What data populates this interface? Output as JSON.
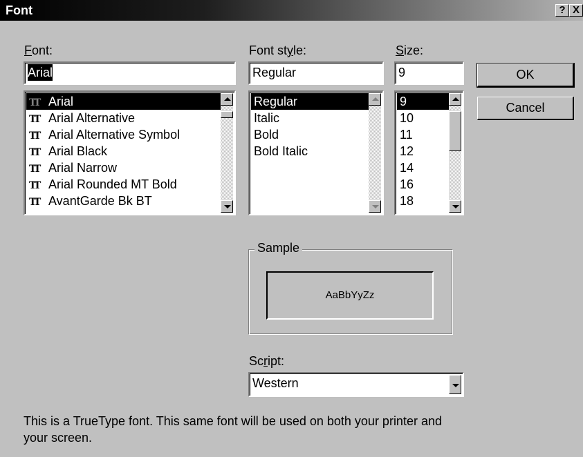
{
  "window": {
    "title": "Font",
    "help_button": "?",
    "close_button": "X"
  },
  "font": {
    "label_accel": "F",
    "label_rest": "ont:",
    "value": "Arial",
    "items": [
      "Arial",
      "Arial Alternative",
      "Arial Alternative Symbol",
      "Arial Black",
      "Arial Narrow",
      "Arial Rounded MT Bold",
      "AvantGarde Bk BT"
    ],
    "selected_index": 0,
    "icon": "truetype-icon"
  },
  "style": {
    "label_pre": "Font st",
    "label_accel": "y",
    "label_post": "le:",
    "value": "Regular",
    "items": [
      "Regular",
      "Italic",
      "Bold",
      "Bold Italic"
    ],
    "selected_index": 0
  },
  "size": {
    "label_accel": "S",
    "label_rest": "ize:",
    "value": "9",
    "items": [
      "9",
      "10",
      "11",
      "12",
      "14",
      "16",
      "18"
    ],
    "selected_index": 0
  },
  "buttons": {
    "ok": "OK",
    "cancel": "Cancel"
  },
  "sample": {
    "label": "Sample",
    "text": "AaBbYyZz"
  },
  "script": {
    "label_pre": "Sc",
    "label_accel": "r",
    "label_post": "ipt:",
    "value": "Western"
  },
  "info": "This is a TrueType font. This same font will be used on both your printer and your screen.",
  "colors": {
    "face": "#c0c0c0",
    "selection": "#000000",
    "title_gradient_start": "#000000",
    "title_gradient_end": "#b4b4b4"
  }
}
